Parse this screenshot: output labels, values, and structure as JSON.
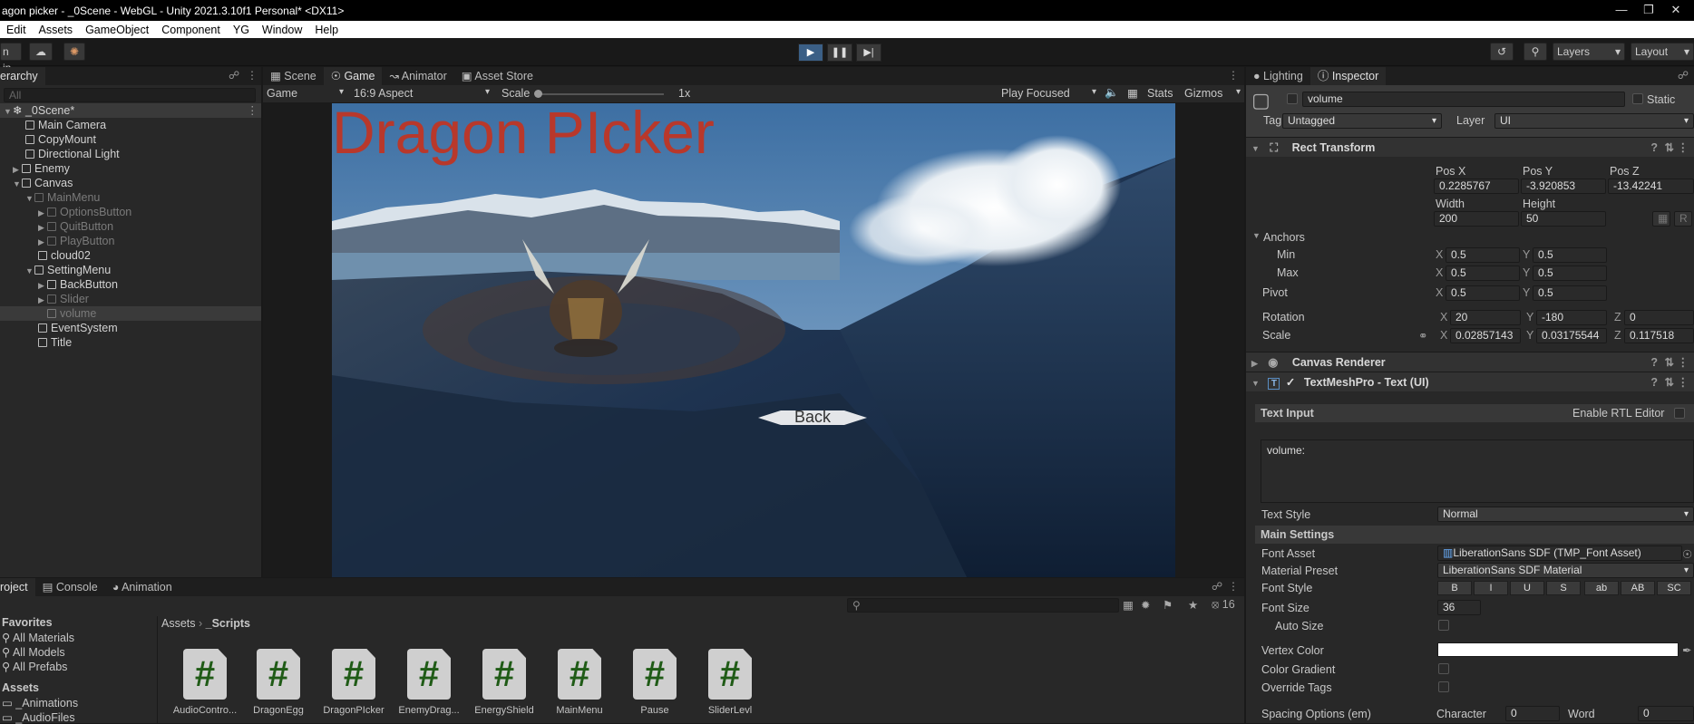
{
  "window": {
    "title": "agon picker - _0Scene - WebGL - Unity 2021.3.10f1 Personal* <DX11>"
  },
  "menu": [
    "Edit",
    "Assets",
    "GameObject",
    "Component",
    "YG",
    "Window",
    "Help"
  ],
  "toolbar": {
    "left_btn": "n in",
    "layers": "Layers",
    "layout": "Layout"
  },
  "hierarchy": {
    "tab": "erarchy",
    "search_placeholder": "All",
    "scene": "_0Scene*",
    "items": [
      {
        "label": "Main Camera"
      },
      {
        "label": "CopyMount"
      },
      {
        "label": "Directional Light"
      },
      {
        "label": "Enemy"
      },
      {
        "label": "Canvas"
      },
      {
        "label": "MainMenu"
      },
      {
        "label": "OptionsButton"
      },
      {
        "label": "QuitButton"
      },
      {
        "label": "PlayButton"
      },
      {
        "label": "cloud02"
      },
      {
        "label": "SettingMenu"
      },
      {
        "label": "BackButton"
      },
      {
        "label": "Slider"
      },
      {
        "label": "volume"
      },
      {
        "label": "EventSystem"
      },
      {
        "label": "Title"
      }
    ]
  },
  "center": {
    "tabs": [
      "Scene",
      "Game",
      "Animator",
      "Asset Store"
    ],
    "game_dropdown": "Game",
    "aspect": "16:9 Aspect",
    "scale_label": "Scale",
    "scale_value": "1x",
    "play_focused": "Play Focused",
    "stats": "Stats",
    "gizmos": "Gizmos",
    "game_title": "Dragon PIcker",
    "back_button": "Back"
  },
  "project": {
    "tabs": [
      "roject",
      "Console",
      "Animation"
    ],
    "favorites_header": "Favorites",
    "favorites": [
      "All Materials",
      "All Models",
      "All Prefabs"
    ],
    "assets_header": "Assets",
    "folders": [
      "_Animations",
      "_AudioFiles"
    ],
    "breadcrumb": [
      "Assets",
      "_Scripts"
    ],
    "hidden_count": "16",
    "scripts": [
      "AudioContro...",
      "DragonEgg",
      "DragonPIcker",
      "EnemyDrag...",
      "EnergyShield",
      "MainMenu",
      "Pause",
      "SliderLevl"
    ]
  },
  "inspector": {
    "tabs": [
      "Lighting",
      "Inspector"
    ],
    "object_name": "volume",
    "static_label": "Static",
    "tag_label": "Tag",
    "tag_value": "Untagged",
    "layer_label": "Layer",
    "layer_value": "UI",
    "rect_transform": "Rect Transform",
    "pos_x_label": "Pos X",
    "pos_y_label": "Pos Y",
    "pos_z_label": "Pos Z",
    "pos_x": "0.2285767",
    "pos_y": "-3.920853",
    "pos_z": "-13.42241",
    "width_label": "Width",
    "height_label": "Height",
    "width": "200",
    "height": "50",
    "anchors": "Anchors",
    "min_label": "Min",
    "max_label": "Max",
    "pivot_label": "Pivot",
    "min_x": "0.5",
    "min_y": "0.5",
    "max_x": "0.5",
    "max_y": "0.5",
    "pivot_x": "0.5",
    "pivot_y": "0.5",
    "rotation_label": "Rotation",
    "rot_x": "20",
    "rot_y": "-180",
    "rot_z": "0",
    "scale_label": "Scale",
    "scale_x": "0.02857143",
    "scale_y": "0.03175544",
    "scale_z": "0.117518",
    "canvas_renderer": "Canvas Renderer",
    "tmp": "TextMeshPro - Text (UI)",
    "text_input": "Text Input",
    "rtl": "Enable RTL Editor",
    "text_value": "volume:",
    "text_style_label": "Text Style",
    "text_style": "Normal",
    "main_settings": "Main Settings",
    "font_asset_label": "Font Asset",
    "font_asset": "LiberationSans SDF (TMP_Font Asset)",
    "material_label": "Material Preset",
    "material": "LiberationSans SDF Material",
    "font_style_label": "Font Style",
    "font_styles": [
      "B",
      "I",
      "U",
      "S",
      "ab",
      "AB",
      "SC"
    ],
    "font_size_label": "Font Size",
    "font_size": "36",
    "auto_size": "Auto Size",
    "vertex_color": "Vertex Color",
    "color_gradient": "Color Gradient",
    "override_tags": "Override Tags",
    "spacing": "Spacing Options (em)",
    "character_label": "Character",
    "character": "0",
    "word_label": "Word",
    "word": "0"
  },
  "colors": {
    "accent": "#2c5d87",
    "title_red": "#b8382b"
  }
}
